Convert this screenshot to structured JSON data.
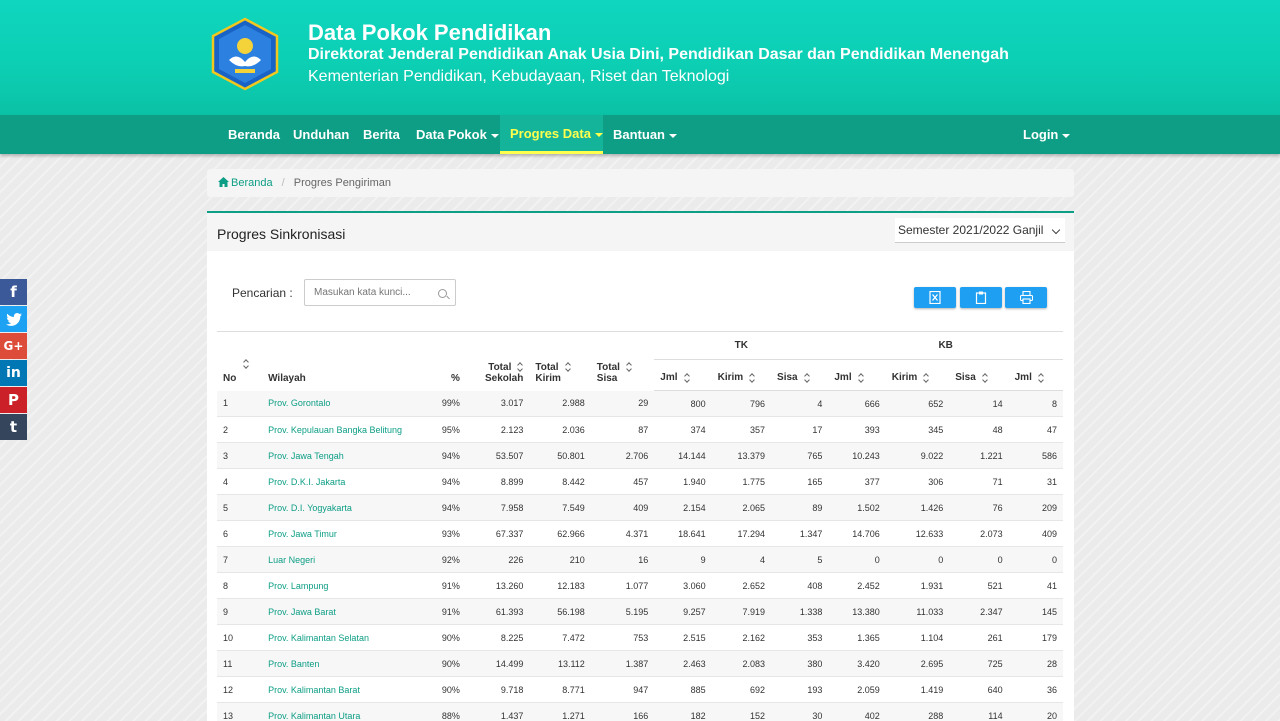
{
  "header": {
    "title": "Data Pokok Pendidikan",
    "subtitle1": "Direktorat Jenderal Pendidikan Anak Usia Dini, Pendidikan Dasar dan Pendidikan Menengah",
    "subtitle2": "Kementerian Pendidikan, Kebudayaan, Riset dan Teknologi",
    "logo_icon": "tut-wuri-handayani-logo"
  },
  "nav": {
    "items": [
      "Beranda",
      "Unduhan",
      "Berita",
      "Data Pokok",
      "Progres Data",
      "Bantuan"
    ],
    "login": "Login",
    "active": "Progres Data"
  },
  "breadcrumb": {
    "home": "Beranda",
    "current": "Progres Pengiriman"
  },
  "panel": {
    "title": "Progres Sinkronisasi",
    "semester": "Semester 2021/2022 Ganjil",
    "search_label": "Pencarian :",
    "search_placeholder": "Masukan kata kunci..."
  },
  "table": {
    "group_tk": "TK",
    "group_kb": "KB",
    "headers": {
      "no": "No",
      "wilayah": "Wilayah",
      "pct": "%",
      "total_sekolah": [
        "Total",
        "Sekolah"
      ],
      "total_kirim": [
        "Total",
        "Kirim"
      ],
      "total_sisa": [
        "Total",
        "Sisa"
      ],
      "jml": "Jml",
      "kirim": "Kirim",
      "sisa": "Sisa"
    },
    "rows": [
      [
        "1",
        "Prov. Gorontalo",
        "99%",
        "3.017",
        "2.988",
        "29",
        "800",
        "796",
        "4",
        "666",
        "652",
        "14",
        "8"
      ],
      [
        "2",
        "Prov. Kepulauan Bangka Belitung",
        "95%",
        "2.123",
        "2.036",
        "87",
        "374",
        "357",
        "17",
        "393",
        "345",
        "48",
        "47"
      ],
      [
        "3",
        "Prov. Jawa Tengah",
        "94%",
        "53.507",
        "50.801",
        "2.706",
        "14.144",
        "13.379",
        "765",
        "10.243",
        "9.022",
        "1.221",
        "586"
      ],
      [
        "4",
        "Prov. D.K.I. Jakarta",
        "94%",
        "8.899",
        "8.442",
        "457",
        "1.940",
        "1.775",
        "165",
        "377",
        "306",
        "71",
        "31"
      ],
      [
        "5",
        "Prov. D.I. Yogyakarta",
        "94%",
        "7.958",
        "7.549",
        "409",
        "2.154",
        "2.065",
        "89",
        "1.502",
        "1.426",
        "76",
        "209"
      ],
      [
        "6",
        "Prov. Jawa Timur",
        "93%",
        "67.337",
        "62.966",
        "4.371",
        "18.641",
        "17.294",
        "1.347",
        "14.706",
        "12.633",
        "2.073",
        "409"
      ],
      [
        "7",
        "Luar Negeri",
        "92%",
        "226",
        "210",
        "16",
        "9",
        "4",
        "5",
        "0",
        "0",
        "0",
        "0"
      ],
      [
        "8",
        "Prov. Lampung",
        "91%",
        "13.260",
        "12.183",
        "1.077",
        "3.060",
        "2.652",
        "408",
        "2.452",
        "1.931",
        "521",
        "41"
      ],
      [
        "9",
        "Prov. Jawa Barat",
        "91%",
        "61.393",
        "56.198",
        "5.195",
        "9.257",
        "7.919",
        "1.338",
        "13.380",
        "11.033",
        "2.347",
        "145"
      ],
      [
        "10",
        "Prov. Kalimantan Selatan",
        "90%",
        "8.225",
        "7.472",
        "753",
        "2.515",
        "2.162",
        "353",
        "1.365",
        "1.104",
        "261",
        "179"
      ],
      [
        "11",
        "Prov. Banten",
        "90%",
        "14.499",
        "13.112",
        "1.387",
        "2.463",
        "2.083",
        "380",
        "3.420",
        "2.695",
        "725",
        "28"
      ],
      [
        "12",
        "Prov. Kalimantan Barat",
        "90%",
        "9.718",
        "8.771",
        "947",
        "885",
        "692",
        "193",
        "2.059",
        "1.419",
        "640",
        "36"
      ],
      [
        "13",
        "Prov. Kalimantan Utara",
        "88%",
        "1.437",
        "1.271",
        "166",
        "182",
        "152",
        "30",
        "402",
        "288",
        "114",
        "20"
      ]
    ]
  },
  "colors": {
    "brand": "#0ccfb4",
    "nav": "#0d9e85",
    "active_text": "#ffff4d",
    "button": "#1e9ff2"
  },
  "social": [
    "facebook-icon",
    "twitter-icon",
    "google-plus-icon",
    "linkedin-icon",
    "pinterest-icon",
    "tumblr-icon"
  ]
}
